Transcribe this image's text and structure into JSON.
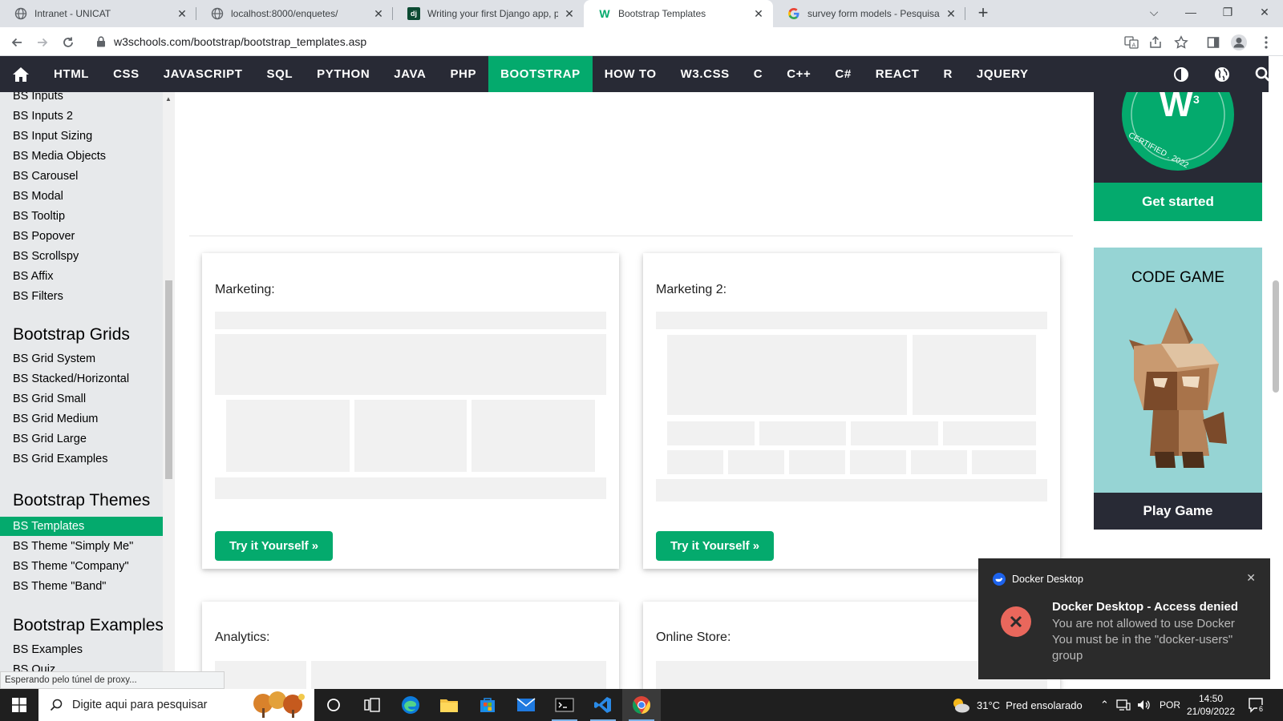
{
  "browser": {
    "tabs": [
      {
        "title": "Intranet - UNICAT",
        "icon": "globe-icon",
        "active": false
      },
      {
        "title": "localhost:8000/enquetes/",
        "icon": "globe-icon",
        "active": false
      },
      {
        "title": "Writing your first Django app, pa",
        "icon": "django-icon",
        "active": false
      },
      {
        "title": "Bootstrap Templates",
        "icon": "w3schools-icon",
        "active": true
      },
      {
        "title": "survey form models - Pesquisa G",
        "icon": "google-icon",
        "active": false
      }
    ],
    "url": "w3schools.com/bootstrap/bootstrap_templates.asp"
  },
  "topnav": {
    "items": [
      "HTML",
      "CSS",
      "JAVASCRIPT",
      "SQL",
      "PYTHON",
      "JAVA",
      "PHP",
      "BOOTSTRAP",
      "HOW TO",
      "W3.CSS",
      "C",
      "C++",
      "C#",
      "REACT",
      "R",
      "JQUERY"
    ],
    "active": "BOOTSTRAP",
    "accent": "#04aa6d",
    "background": "#282a35"
  },
  "sidebar": {
    "partial_top": "BS Inputs",
    "group1": [
      "BS Inputs 2",
      "BS Input Sizing",
      "BS Media Objects",
      "BS Carousel",
      "BS Modal",
      "BS Tooltip",
      "BS Popover",
      "BS Scrollspy",
      "BS Affix",
      "BS Filters"
    ],
    "heading_grids": "Bootstrap Grids",
    "grids": [
      "BS Grid System",
      "BS Stacked/Horizontal",
      "BS Grid Small",
      "BS Grid Medium",
      "BS Grid Large",
      "BS Grid Examples"
    ],
    "heading_themes": "Bootstrap Themes",
    "themes": [
      "BS Templates",
      "BS Theme \"Simply Me\"",
      "BS Theme \"Company\"",
      "BS Theme \"Band\""
    ],
    "active_item": "BS Templates",
    "heading_examples": "Bootstrap Examples",
    "examples": [
      "BS Examples"
    ],
    "partial_bottom": "BS Quiz"
  },
  "main": {
    "cards": [
      {
        "title": "Marketing:",
        "button": "Try it Yourself »"
      },
      {
        "title": "Marketing 2:",
        "button": "Try it Yourself »"
      },
      {
        "title": "Analytics:"
      },
      {
        "title": "Online Store:"
      }
    ]
  },
  "right": {
    "cert_badge_text": "CERTIFIED . 2022",
    "cert_button": "Get started",
    "game_title": "CODE GAME",
    "game_button": "Play Game"
  },
  "toast": {
    "app": "Docker Desktop",
    "title": "Docker Desktop - Access denied",
    "line1": "You are not allowed to use Docker",
    "line2": "You must be in the \"docker-users\" group"
  },
  "status_text": "Esperando pelo túnel de proxy...",
  "taskbar": {
    "search_placeholder": "Digite aqui para pesquisar",
    "weather": "31°C  Pred ensolarado",
    "language": "POR",
    "time": "14:50",
    "date": "21/09/2022",
    "notifications": "6"
  }
}
